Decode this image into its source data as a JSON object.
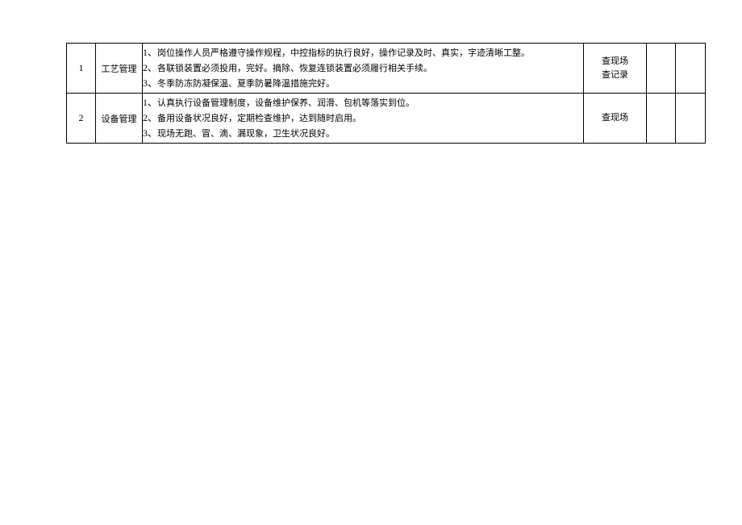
{
  "rows": [
    {
      "num": "1",
      "category": "工艺管理",
      "content_lines": [
        {
          "prefix": "1、",
          "text": "岗位操作人员严格遵守操作规程，中控指标的执行良好，操作记录及时、真实，字迹清晰工整。"
        },
        {
          "prefix": "2、",
          "text": "各联锁装置必须投用，完好。摘除、恢复连锁装置必须履行相关手续。"
        },
        {
          "prefix": "3、",
          "text": "冬季防冻防凝保温、夏季防暑降温措施完好。"
        }
      ],
      "check_lines": [
        "查现场",
        "查记录"
      ]
    },
    {
      "num": "2",
      "category": "设备管理",
      "content_lines": [
        {
          "prefix": "1、",
          "text": "认真执行设备管理制度，设备维护保养、润滑、包机等落实到位。"
        },
        {
          "prefix": "2、",
          "text": "备用设备状况良好，定期检查维护，达到随时启用。"
        },
        {
          "prefix": "3、",
          "text": "现场无跑、冒、滴、漏现象，卫生状况良好。"
        }
      ],
      "check_lines": [
        "查现场"
      ]
    }
  ]
}
